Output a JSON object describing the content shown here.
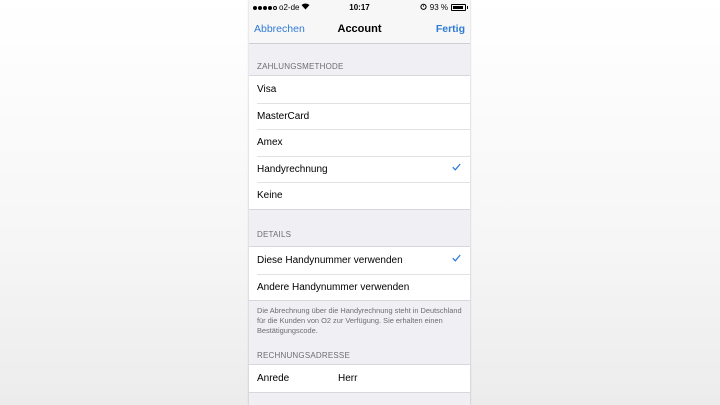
{
  "status_bar": {
    "carrier": "o2-de",
    "time": "10:17",
    "battery_text": "93 %",
    "battery_level": 0.93
  },
  "nav": {
    "left_button": "Abbrechen",
    "title": "Account",
    "right_button": "Fertig",
    "accent_color": "#2f7bd6"
  },
  "payment": {
    "header": "ZAHLUNGSMETHODE",
    "options": [
      {
        "label": "Visa",
        "selected": false
      },
      {
        "label": "MasterCard",
        "selected": false
      },
      {
        "label": "Amex",
        "selected": false
      },
      {
        "label": "Handyrechnung",
        "selected": true
      },
      {
        "label": "Keine",
        "selected": false
      }
    ]
  },
  "details": {
    "header": "DETAILS",
    "options": [
      {
        "label": "Diese Handynummer verwenden",
        "selected": true
      },
      {
        "label": "Andere Handynummer verwenden",
        "selected": false
      }
    ],
    "note": "Die Abrechnung über die Handyrechnung steht in Deutschland für die Kunden von O2 zur Verfügung. Sie erhalten einen Bestätigungscode."
  },
  "billing": {
    "header": "RECHNUNGSADRESSE",
    "rows": [
      {
        "label": "Anrede",
        "value": "Herr"
      }
    ]
  },
  "icons": {
    "checkmark": "checkmark-icon",
    "wifi": "wifi-icon",
    "alarm": "alarm-icon",
    "battery": "battery-icon",
    "signal": "signal-icon"
  }
}
